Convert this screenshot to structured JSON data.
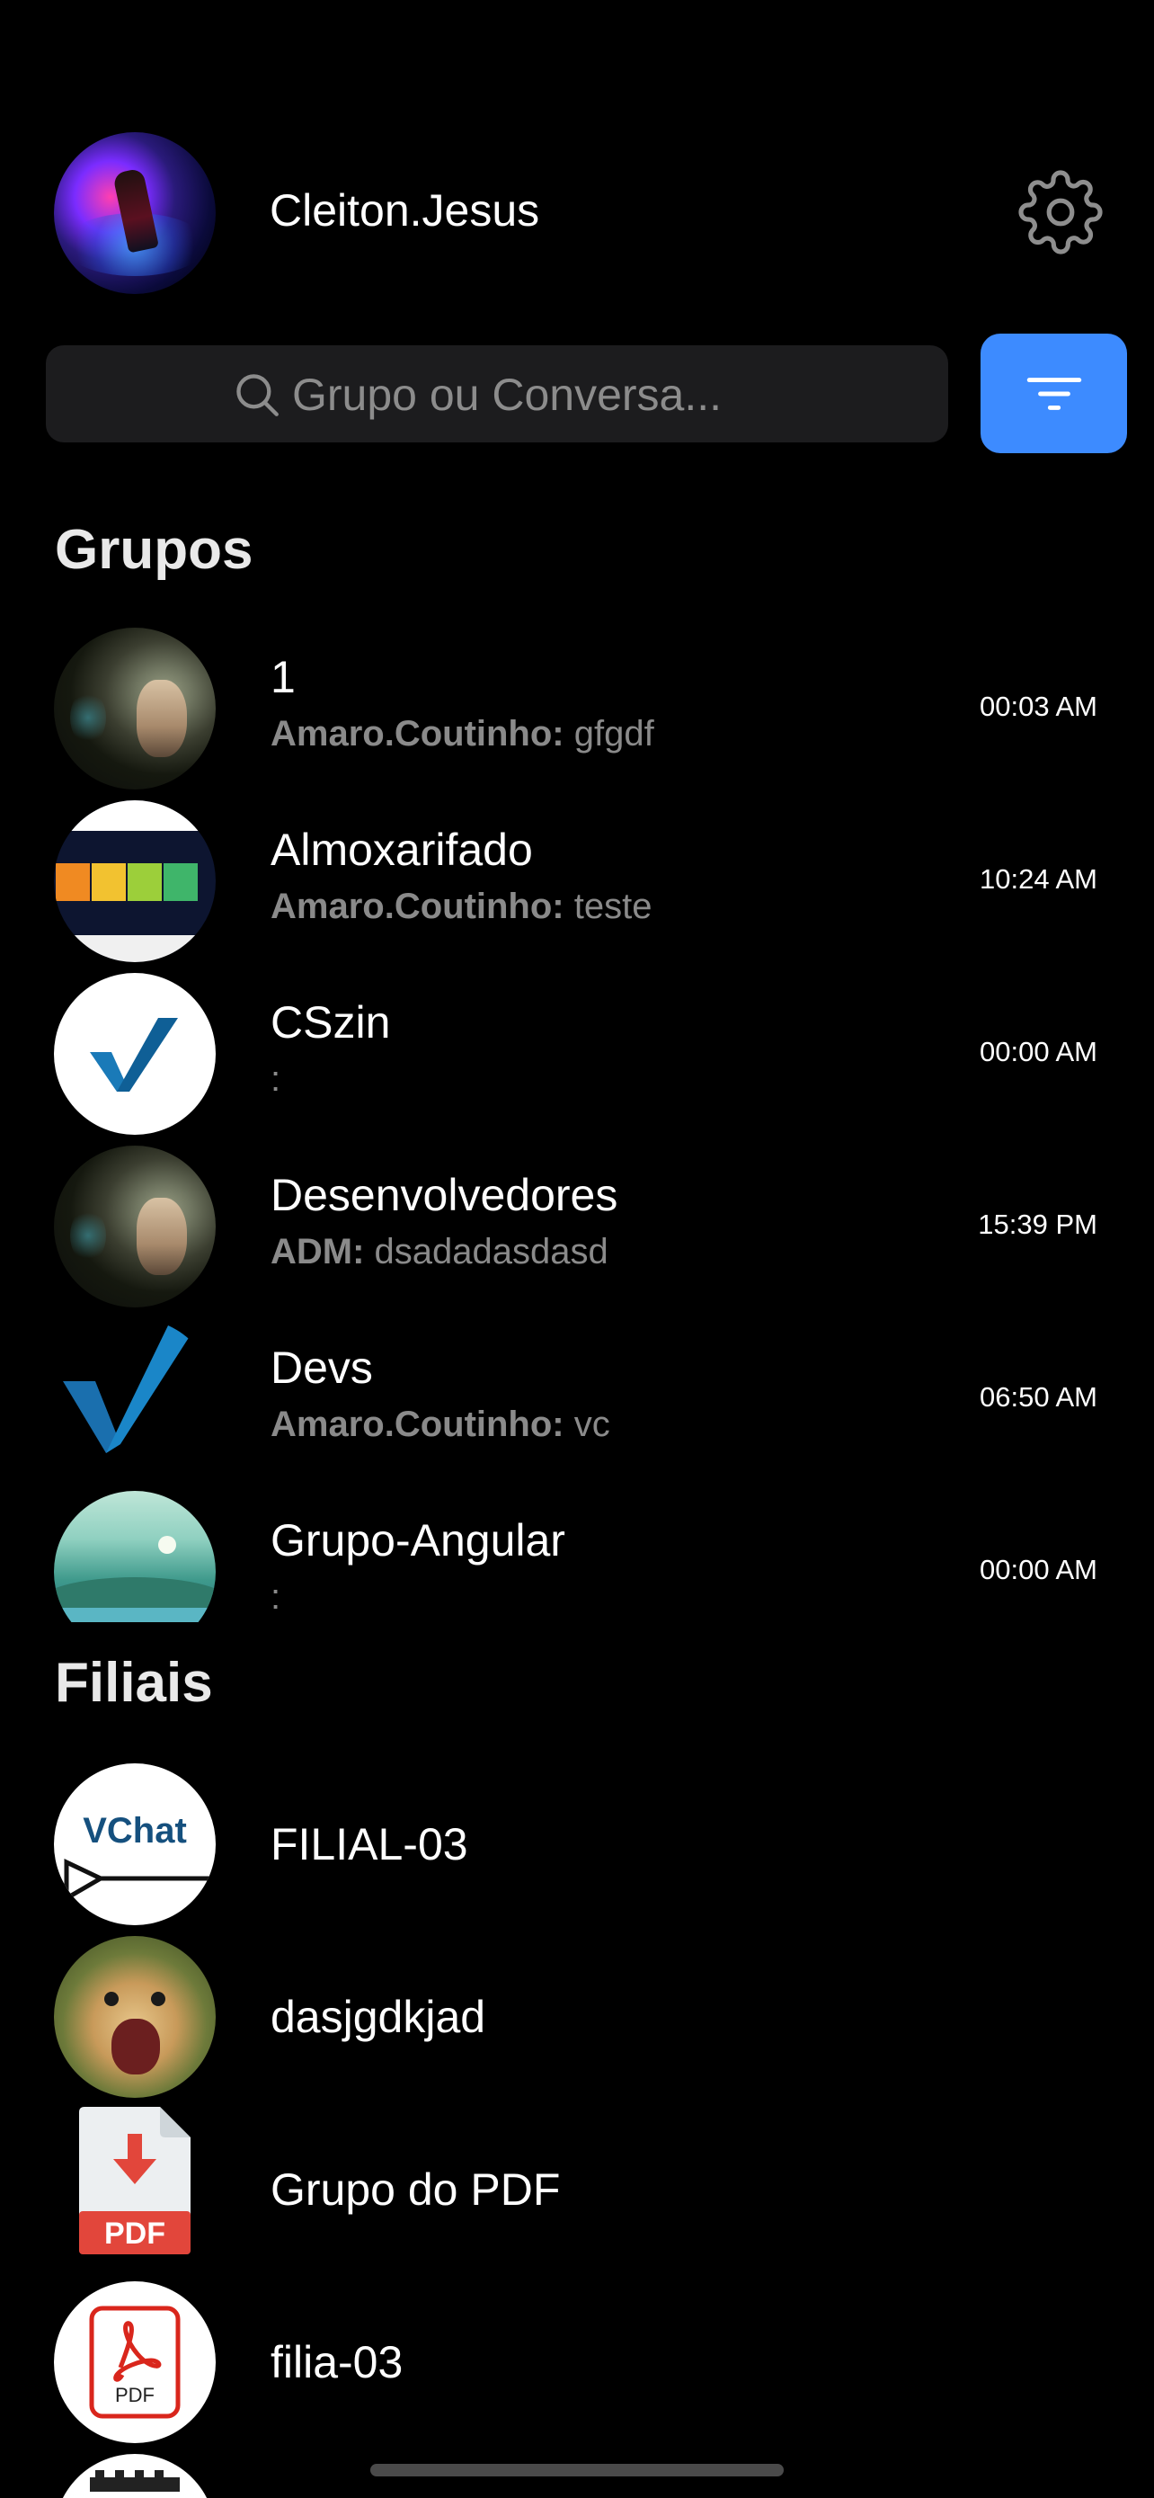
{
  "header": {
    "username": "Cleiton.Jesus",
    "settings_icon": "gear-icon"
  },
  "search": {
    "placeholder": "Grupo ou Conversa...",
    "value": "",
    "icon": "search-icon"
  },
  "filter_button": {
    "icon": "filter-icon",
    "color": "#3d8bff"
  },
  "sections": {
    "groups_title": "Grupos",
    "filiais_title": "Filiais"
  },
  "groups": [
    {
      "name": "1",
      "sender": "Amaro.Coutinho:",
      "message": "gfgdf",
      "time": "00:03 AM"
    },
    {
      "name": "Almoxarifado",
      "sender": "Amaro.Coutinho:",
      "message": "teste",
      "time": "10:24 AM"
    },
    {
      "name": "CSzin",
      "sender": "",
      "message": ":",
      "time": "00:00 AM"
    },
    {
      "name": "Desenvolvedores",
      "sender": "ADM:",
      "message": "dsadadasdasd",
      "time": "15:39 PM"
    },
    {
      "name": "Devs",
      "sender": "Amaro.Coutinho:",
      "message": "vc",
      "time": "06:50 AM"
    },
    {
      "name": "Grupo-Angular",
      "sender": "",
      "message": ":",
      "time": "00:00 AM"
    }
  ],
  "filiais": [
    {
      "name": "FILIAL-03",
      "logo_text": "VChat"
    },
    {
      "name": "dasjgdkjad"
    },
    {
      "name": "Grupo do PDF",
      "badge": "PDF"
    },
    {
      "name": "filia-03",
      "badge": "PDF"
    }
  ],
  "colors": {
    "background": "#000000",
    "accent": "#3d8bff",
    "muted_text": "#8a8a8a",
    "search_bg": "#1c1c1e"
  }
}
